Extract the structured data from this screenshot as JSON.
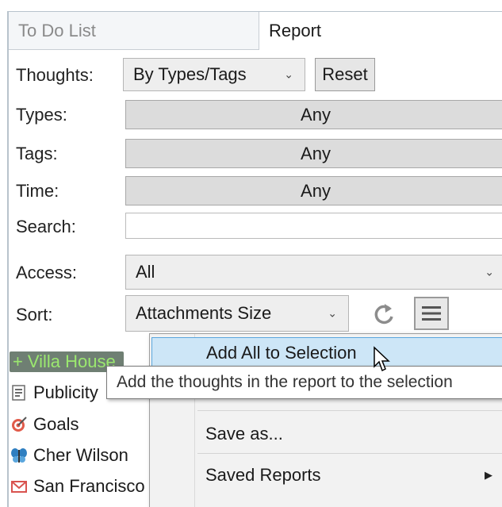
{
  "tabs": [
    {
      "label": "To Do List"
    },
    {
      "label": "Report"
    }
  ],
  "filters": {
    "thoughts": {
      "label": "Thoughts:",
      "value": "By Types/Tags",
      "reset_label": "Reset"
    },
    "types": {
      "label": "Types:",
      "value": "Any"
    },
    "tags": {
      "label": "Tags:",
      "value": "Any"
    },
    "time": {
      "label": "Time:",
      "value": "Any"
    },
    "search": {
      "label": "Search:",
      "value": ""
    },
    "access": {
      "label": "Access:",
      "value": "All"
    },
    "sort": {
      "label": "Sort:",
      "value": "Attachments Size"
    }
  },
  "results": [
    {
      "label": "Villa House",
      "icon": "plus-icon"
    },
    {
      "label": "Publicity",
      "icon": "document-icon"
    },
    {
      "label": "Goals",
      "icon": "target-icon"
    },
    {
      "label": "Cher Wilson",
      "icon": "butterfly-icon"
    },
    {
      "label": "San Francisco",
      "icon": "mail-icon"
    }
  ],
  "menu": {
    "items": [
      {
        "label": "Add All to Selection",
        "highlighted": true
      },
      {
        "label": "Save as..."
      },
      {
        "label": "Saved Reports",
        "has_submenu": true
      }
    ]
  },
  "tooltip": {
    "text": "Add the thoughts in the report to the selection"
  },
  "colors": {
    "menu_highlight": "#cde6f7",
    "menu_highlight_border": "#5aa6dd",
    "villa_text": "#9be86f"
  }
}
